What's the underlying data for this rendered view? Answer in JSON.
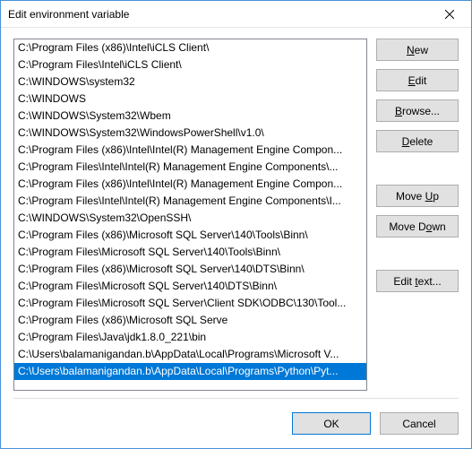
{
  "window": {
    "title": "Edit environment variable"
  },
  "list": {
    "items": [
      "C:\\Program Files (x86)\\Intel\\iCLS Client\\",
      "C:\\Program Files\\Intel\\iCLS Client\\",
      "C:\\WINDOWS\\system32",
      "C:\\WINDOWS",
      "C:\\WINDOWS\\System32\\Wbem",
      "C:\\WINDOWS\\System32\\WindowsPowerShell\\v1.0\\",
      "C:\\Program Files (x86)\\Intel\\Intel(R) Management Engine Compon...",
      "C:\\Program Files\\Intel\\Intel(R) Management Engine Components\\...",
      "C:\\Program Files (x86)\\Intel\\Intel(R) Management Engine Compon...",
      "C:\\Program Files\\Intel\\Intel(R) Management Engine Components\\I...",
      "C:\\WINDOWS\\System32\\OpenSSH\\",
      "C:\\Program Files (x86)\\Microsoft SQL Server\\140\\Tools\\Binn\\",
      "C:\\Program Files\\Microsoft SQL Server\\140\\Tools\\Binn\\",
      "C:\\Program Files (x86)\\Microsoft SQL Server\\140\\DTS\\Binn\\",
      "C:\\Program Files\\Microsoft SQL Server\\140\\DTS\\Binn\\",
      "C:\\Program Files\\Microsoft SQL Server\\Client SDK\\ODBC\\130\\Tool...",
      "C:\\Program Files (x86)\\Microsoft SQL Serve",
      "C:\\Program Files\\Java\\jdk1.8.0_221\\bin",
      "C:\\Users\\balamanigandan.b\\AppData\\Local\\Programs\\Microsoft V...",
      "C:\\Users\\balamanigandan.b\\AppData\\Local\\Programs\\Python\\Pyt..."
    ],
    "selected_index": 19
  },
  "side_buttons": {
    "new_left": "",
    "new_accel": "N",
    "new_right": "ew",
    "edit_left": "",
    "edit_accel": "E",
    "edit_right": "dit",
    "browse_left": "",
    "browse_accel": "B",
    "browse_right": "rowse...",
    "delete_left": "",
    "delete_accel": "D",
    "delete_right": "elete",
    "moveup_left": "Move ",
    "moveup_accel": "U",
    "moveup_right": "p",
    "movedown_left": "Move D",
    "movedown_accel": "o",
    "movedown_right": "wn",
    "edittext_left": "Edit ",
    "edittext_accel": "t",
    "edittext_right": "ext..."
  },
  "footer": {
    "ok": "OK",
    "cancel": "Cancel"
  }
}
